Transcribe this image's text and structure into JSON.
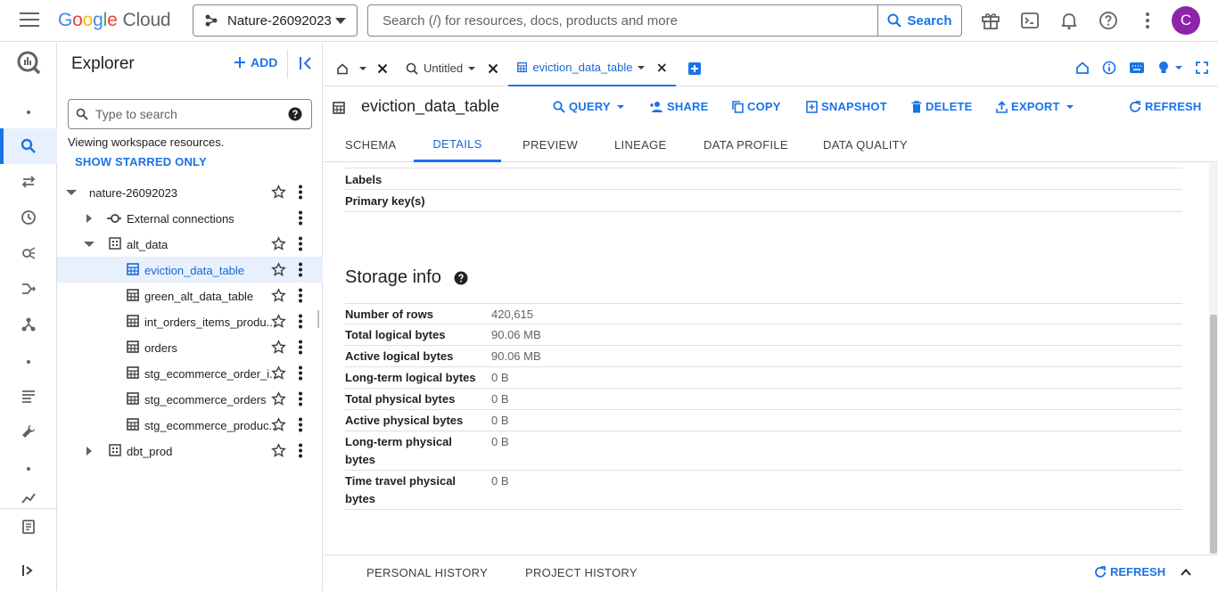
{
  "brand": {
    "logo_letters": [
      "G",
      "o",
      "o",
      "g",
      "l",
      "e"
    ],
    "logo_suffix": "Cloud"
  },
  "topbar": {
    "project_name": "Nature-26092023",
    "search_placeholder": "Search (/) for resources, docs, products and more",
    "search_button": "Search",
    "avatar_letter": "C"
  },
  "explorer": {
    "title": "Explorer",
    "add_label": "ADD",
    "search_placeholder": "Type to search",
    "viewing_text": "Viewing workspace resources.",
    "starred_label": "SHOW STARRED ONLY",
    "tree": [
      {
        "label": "nature-26092023"
      },
      {
        "label": "External connections"
      },
      {
        "label": "alt_data"
      },
      {
        "label": "eviction_data_table"
      },
      {
        "label": "green_alt_data_table"
      },
      {
        "label": "int_orders_items_produ..."
      },
      {
        "label": "orders"
      },
      {
        "label": "stg_ecommerce_order_i..."
      },
      {
        "label": "stg_ecommerce_orders"
      },
      {
        "label": "stg_ecommerce_produc..."
      },
      {
        "label": "dbt_prod"
      }
    ]
  },
  "editor_tabs": [
    {
      "label": ""
    },
    {
      "label": "Untitled"
    },
    {
      "label": "eviction_data_table"
    }
  ],
  "table": {
    "title": "eviction_data_table",
    "actions": {
      "query": "QUERY",
      "share": "SHARE",
      "copy": "COPY",
      "snapshot": "SNAPSHOT",
      "delete": "DELETE",
      "export": "EXPORT",
      "refresh": "REFRESH"
    },
    "subtabs": [
      "SCHEMA",
      "DETAILS",
      "PREVIEW",
      "LINEAGE",
      "DATA PROFILE",
      "DATA QUALITY"
    ]
  },
  "details": {
    "top_rows": [
      {
        "key": "Labels",
        "value": ""
      },
      {
        "key": "Primary key(s)",
        "value": ""
      }
    ],
    "storage_title": "Storage info",
    "storage_rows": [
      {
        "key": "Number of rows",
        "value": "420,615"
      },
      {
        "key": "Total logical bytes",
        "value": "90.06 MB"
      },
      {
        "key": "Active logical bytes",
        "value": "90.06 MB"
      },
      {
        "key": "Long-term logical bytes",
        "value": "0 B"
      },
      {
        "key": "Total physical bytes",
        "value": "0 B"
      },
      {
        "key": "Active physical bytes",
        "value": "0 B"
      },
      {
        "key": "Long-term physical bytes",
        "value": "0 B"
      },
      {
        "key": "Time travel physical bytes",
        "value": "0 B"
      }
    ]
  },
  "history": {
    "personal": "PERSONAL HISTORY",
    "project": "PROJECT HISTORY",
    "refresh": "REFRESH"
  },
  "colors": {
    "accent": "#1a73e8",
    "selected_bg": "#e8f0fe",
    "avatar": "#8e24aa"
  },
  "icons": {
    "rail": [
      "bigquery-logo-icon",
      "dot-icon",
      "search-icon",
      "transfer-icon",
      "history-icon",
      "analytics-icon",
      "pipeline-icon",
      "graph-icon",
      "dot-icon",
      "list-icon",
      "wrench-icon",
      "dot-icon",
      "chart-icon",
      "document-icon",
      "expand-rail-icon"
    ]
  }
}
